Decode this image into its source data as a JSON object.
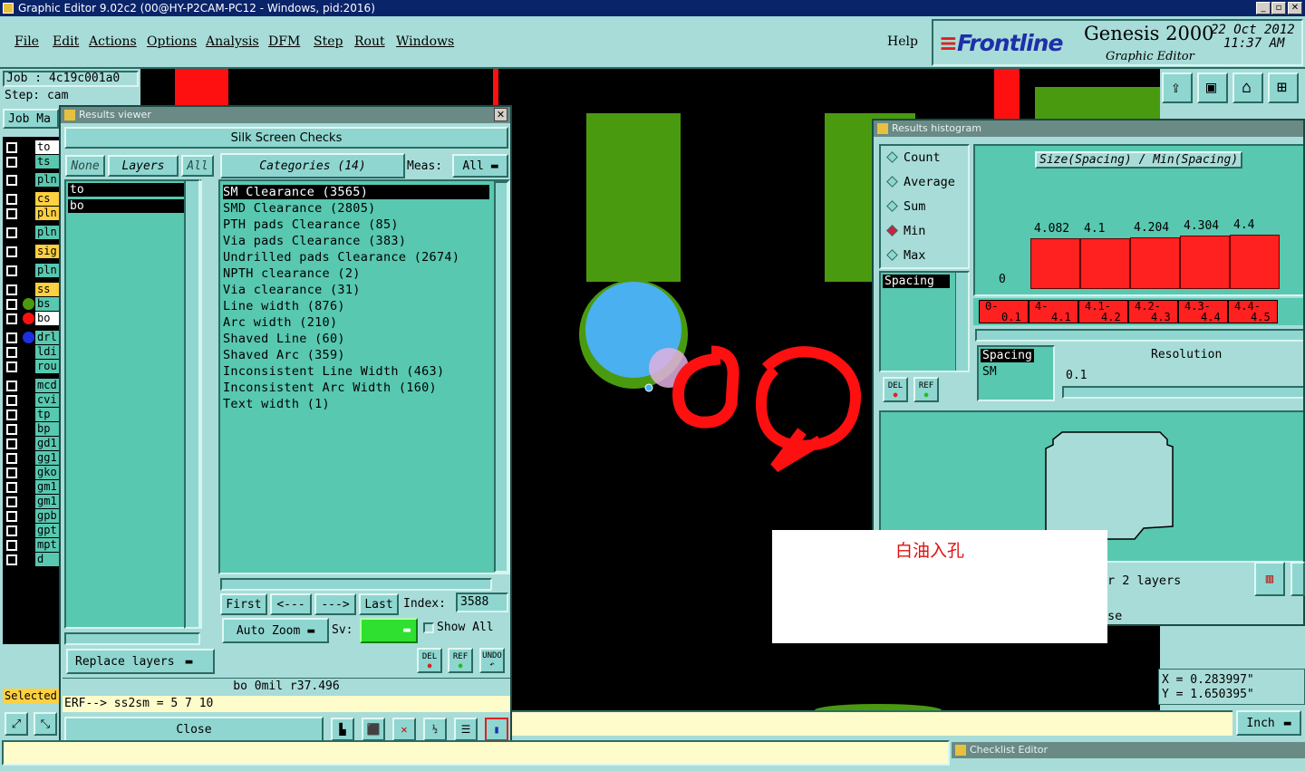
{
  "app": {
    "title": "Graphic Editor 9.02c2 (00@HY-P2CAM-PC12 - Windows, pid:2016)"
  },
  "menu": [
    "File",
    "Edit",
    "Actions",
    "Options",
    "Analysis",
    "DFM",
    "Step",
    "Rout",
    "Windows"
  ],
  "help": "Help",
  "brand": {
    "logo": "Frontline",
    "product": "Genesis 2000",
    "sub": "Graphic Editor",
    "date": "22 Oct 2012",
    "time": "11:37 AM"
  },
  "job": {
    "job": "Job : 4c19c001a0",
    "step": "Step: cam",
    "tab": "Job Ma",
    "selected": "Selected"
  },
  "layers": [
    {
      "name": "to",
      "color": "#ffffff"
    },
    {
      "name": "ts",
      "color": "#58c8b0"
    },
    {
      "name": "pln",
      "color": "#58c8b0"
    },
    {
      "name": "cs",
      "color": "#ffd040"
    },
    {
      "name": "pln",
      "color": "#ffd040"
    },
    {
      "name": "pln",
      "color": "#58c8b0"
    },
    {
      "name": "sig",
      "color": "#ffd040"
    },
    {
      "name": "pln",
      "color": "#58c8b0"
    },
    {
      "name": "ss",
      "color": "#ffd040"
    },
    {
      "name": "bs",
      "color": "#58c8b0"
    },
    {
      "name": "bo",
      "color": "#ffffff"
    },
    {
      "name": "drl",
      "color": "#58c8b0"
    },
    {
      "name": "ldi",
      "color": "#58c8b0"
    },
    {
      "name": "rou",
      "color": "#58c8b0"
    },
    {
      "name": "mcd",
      "color": "#58c8b0"
    },
    {
      "name": "cvi",
      "color": "#58c8b0"
    },
    {
      "name": "tp",
      "color": "#58c8b0"
    },
    {
      "name": "bp",
      "color": "#58c8b0"
    },
    {
      "name": "gd1",
      "color": "#58c8b0"
    },
    {
      "name": "gg1",
      "color": "#58c8b0"
    },
    {
      "name": "gko",
      "color": "#58c8b0"
    },
    {
      "name": "gm1",
      "color": "#58c8b0"
    },
    {
      "name": "gm1",
      "color": "#58c8b0"
    },
    {
      "name": "gpb",
      "color": "#58c8b0"
    },
    {
      "name": "gpt",
      "color": "#58c8b0"
    },
    {
      "name": "mpt",
      "color": "#58c8b0"
    },
    {
      "name": "d",
      "color": "#58c8b0"
    }
  ],
  "results": {
    "title": "Results viewer",
    "header": "Silk Screen Checks",
    "none": "None",
    "layers_label": "Layers",
    "all": "All",
    "layer_items": [
      "to",
      "bo"
    ],
    "categories_label": "Categories (14)",
    "meas_label": "Meas:",
    "meas_value": "All",
    "categories": [
      "SM Clearance (3565)",
      "SMD Clearance (2805)",
      "PTH pads Clearance (85)",
      "Via pads Clearance (383)",
      "Undrilled pads Clearance (2674)",
      "NPTH clearance (2)",
      "Via clearance (31)",
      "Line width (876)",
      "Arc width (210)",
      "Shaved Line (60)",
      "Shaved Arc (359)",
      "Inconsistent Line Width (463)",
      "Inconsistent Arc Width (160)",
      "Text width (1)"
    ],
    "first": "First",
    "prev": "<---",
    "next": "--->",
    "last": "Last",
    "index_label": "Index:",
    "index_value": "3588",
    "auto_zoom": "Auto Zoom",
    "sv_label": "Sv:",
    "show_all": "Show All",
    "replace_layers": "Replace layers",
    "del": "DEL",
    "ref": "REF",
    "undo": "UNDO",
    "status": "bo  0mil   r37.496",
    "erf": "ERF--> ss2sm = 5 7 10",
    "close": "Close"
  },
  "histogram": {
    "title": "Results histogram",
    "modes": [
      "Count",
      "Average",
      "Sum",
      "Min",
      "Max"
    ],
    "selected_mode": "Min",
    "chart_title": "Size(Spacing) / Min(Spacing)",
    "spacing_label": "Spacing",
    "del": "DEL",
    "ref": "REF",
    "spacing_sel": "Spacing",
    "sm": "SM",
    "resolution_label": "Resolution",
    "resolution_value": "0.1",
    "layers_text": "r 2 layers",
    "close_text": "se"
  },
  "chart_data": {
    "type": "bar",
    "title": "Size(Spacing) / Min(Spacing)",
    "categories": [
      "0-0.1",
      "4-4.1",
      "4.1-4.2",
      "4.2-4.3",
      "4.3-4.4",
      "4.4-4.5"
    ],
    "values": [
      0,
      4.082,
      4.1,
      4.204,
      4.304,
      4.4
    ],
    "value_labels": [
      "0",
      "4.082",
      "4.1",
      "4.204",
      "4.304",
      "4.4"
    ],
    "bin_labels_top": [
      "0-",
      "4-",
      "4.1-",
      "4.2-",
      "4.3-",
      "4.4-"
    ],
    "bin_labels_bottom": [
      "0.1",
      "4.1",
      "4.2",
      "4.3",
      "4.4",
      "4.5"
    ],
    "color": "#ff2020"
  },
  "annotation": "白油入孔",
  "coords": {
    "x": "X  = 0.283997\"",
    "y": "Y  = 1.650395\""
  },
  "unit": "Inch",
  "checklist": "Checklist Editor"
}
